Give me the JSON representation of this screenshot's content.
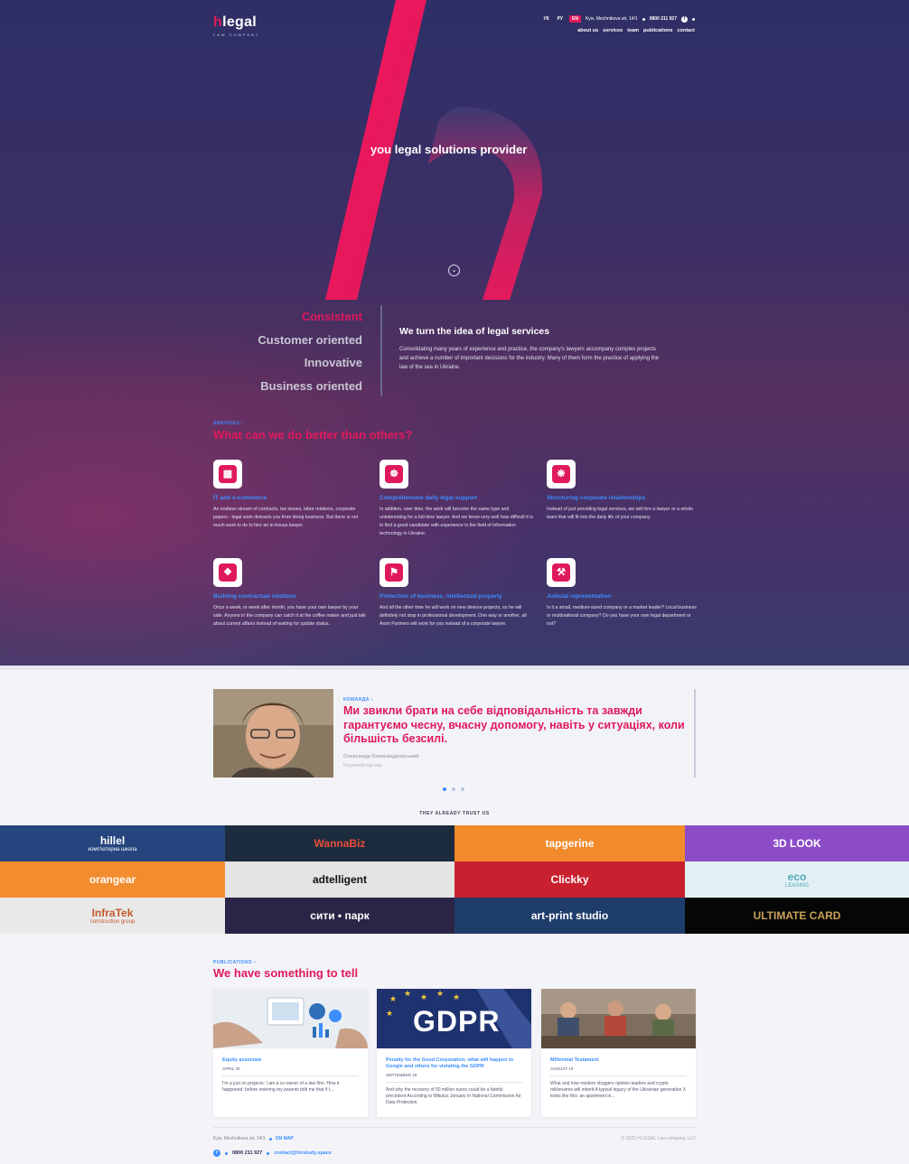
{
  "header": {
    "logo_accent": "h",
    "logo_word": "legal",
    "logo_sub": "LAW COMPANY",
    "langs": [
      "УК",
      "РУ",
      "EN"
    ],
    "active_lang": "EN",
    "address": "Kyiv, Mechnikova str, 14/1",
    "phone": "0800 211 927",
    "social_icon": "facebook-icon",
    "nav": [
      "about us",
      "services",
      "team",
      "publications",
      "contact"
    ]
  },
  "hero": {
    "tagline": "you legal solutions provider",
    "scroll_icon": "chevron-down-icon"
  },
  "values": [
    "Consistent",
    "Customer oriented",
    "Innovative",
    "Business oriented"
  ],
  "about": {
    "title": "We turn the idea of legal services",
    "text": "Consolidating many years of experience and practice, the company's lawyers accompany complex projects and achieve a number of important decisions for the industry. Many of them form the practice of applying the law of the sea in Ukraine."
  },
  "services": {
    "label": "SERVICES ›",
    "title": "What can we do better than others?",
    "items": [
      {
        "icon": "briefcase-icon",
        "name": "IT and e-commerce",
        "desc": "An endless stream of contracts, tax issues, labor relations, corporate papers - legal work distracts you from doing business. But there is not much work to do to hire an in-house lawyer."
      },
      {
        "icon": "basket-icon",
        "name": "Comprehensive daily legal support",
        "desc": "In addition, over time, the work will become the same type and uninteresting for a full-time lawyer. And we know very well how difficult it is to find a good candidate with experience in the field of information technology in Ukraine."
      },
      {
        "icon": "network-icon",
        "name": "Structuring corporate relationships",
        "desc": "Instead of just providing legal services, we will hire a lawyer or a whole team that will fit into the daily life of your company."
      },
      {
        "icon": "handshake-icon",
        "name": "Building contractual relations",
        "desc": "Once a week, or week after month, you have your own lawyer by your side. Anyone in the company can catch it at the coffee maker and just talk about current affairs instead of waiting for update status."
      },
      {
        "icon": "shield-icon",
        "name": "Protection of business, intellectual property",
        "desc": "And all the other time he will work on new diverse projects, so he will definitely not stop in professional development. One way or another, all Axon Partners will work for you instead of a corporate lawyer."
      },
      {
        "icon": "gavel-icon",
        "name": "Judicial representation",
        "desc": "Is it a small, medium-sized company or a market leader? Local business or multinational company? Do you have your own legal department or not?"
      }
    ]
  },
  "team": {
    "label": "КОМАНДА ›",
    "quote": "Ми звикли брати на себе відповідальність та завжди гарантуємо чесну, вчасну допомогу, навіть у ситуаціях, коли більшість безсилі.",
    "author": "Олександр Олександровський",
    "role": "Керуючий партнер"
  },
  "trust": {
    "title": "THEY ALREADY TRUST US",
    "logos": [
      {
        "name": "hillel",
        "sub": "комп'ютерна школа",
        "bg": "#26457e",
        "color": "#ffffff"
      },
      {
        "name": "WannaBiz",
        "sub": "",
        "bg": "#1c2b3d",
        "color": "#e94e3d"
      },
      {
        "name": "tapgerine",
        "sub": "",
        "bg": "#f08a2b",
        "color": "#ffffff"
      },
      {
        "name": "3D LOOK",
        "sub": "",
        "bg": "#8c4cc7",
        "color": "#ffffff"
      },
      {
        "name": "orangear",
        "sub": "",
        "bg": "#f28c2e",
        "color": "#ffffff"
      },
      {
        "name": "adtelligent",
        "sub": "",
        "bg": "#e4e4e4",
        "color": "#111111"
      },
      {
        "name": "Clickky",
        "sub": "",
        "bg": "#c8202f",
        "color": "#ffffff"
      },
      {
        "name": "eco",
        "sub": "LEASING",
        "bg": "#e3f1f4",
        "color": "#4ea8b6"
      },
      {
        "name": "InfraTek",
        "sub": "construction group",
        "bg": "#e9e9ea",
        "color": "#c45a2b"
      },
      {
        "name": "сити • парк",
        "sub": "",
        "bg": "#2a2446",
        "color": "#ffffff"
      },
      {
        "name": "art-print studio",
        "sub": "",
        "bg": "#1f3d6b",
        "color": "#ffffff"
      },
      {
        "name": "ULTIMATE CARD",
        "sub": "",
        "bg": "#060606",
        "color": "#c9a25a"
      }
    ]
  },
  "publications": {
    "label": "PUBLICATIONS ›",
    "title": "We have something to tell",
    "items": [
      {
        "title": "Equity associate",
        "date": "APRIL 30",
        "text": "I'm a just on projects: I am a co-owner of a law firm. How it happened: before entering my parents told me that if I..."
      },
      {
        "title": "Penalty for the Good Corporation: what will happen to Google and others for violating the GDPR",
        "date": "SEPTEMBER 18",
        "text": "And why the recovery of 50 million euros could be a fateful precedent According to Mikulus January in National Commission for Data Protection.",
        "img_text": "GDPR"
      },
      {
        "title": "Millennial Testament",
        "date": "AUGUST 19",
        "text": "What and how modern vloggers opinion leaders and crypto millionaires will inherit A typical legacy of the Ukrainian generation X looks like this: an apartment in..."
      }
    ]
  },
  "footer": {
    "address": "Kyiv, Mechnikova str, 14/1",
    "map_link": "ON MAP",
    "copyright": "© 2021 H.LEGAL Law company, LLC",
    "phone": "0800 211 927",
    "email": "contact@forstudy.space"
  },
  "colors": {
    "accent": "#e0195c",
    "link": "#3c8dff",
    "hero_bg": "#2e2f66"
  }
}
